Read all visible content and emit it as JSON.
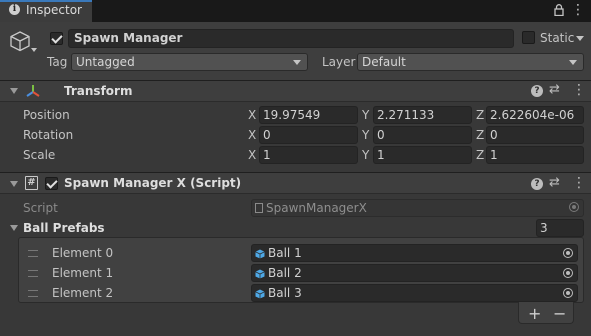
{
  "tab": {
    "label": "Inspector"
  },
  "header": {
    "object_name": "Spawn Manager",
    "static_label": "Static",
    "tag_label": "Tag",
    "tag_value": "Untagged",
    "layer_label": "Layer",
    "layer_value": "Default"
  },
  "transform": {
    "title": "Transform",
    "rows": [
      {
        "label": "Position",
        "x": "19.97549",
        "y": "2.271133",
        "z": "2.622604e-06"
      },
      {
        "label": "Rotation",
        "x": "0",
        "y": "0",
        "z": "0"
      },
      {
        "label": "Scale",
        "x": "1",
        "y": "1",
        "z": "1"
      }
    ],
    "axis": {
      "x": "X",
      "y": "Y",
      "z": "Z"
    }
  },
  "script_component": {
    "title": "Spawn Manager X (Script)",
    "hash_label": "#",
    "script_label": "Script",
    "script_value": "SpawnManagerX",
    "list_label": "Ball Prefabs",
    "list_count": "3",
    "elements": [
      {
        "label": "Element 0",
        "value": "Ball 1"
      },
      {
        "label": "Element 1",
        "value": "Ball 2"
      },
      {
        "label": "Element 2",
        "value": "Ball 3"
      }
    ],
    "add_label": "+",
    "remove_label": "−"
  },
  "icons": {
    "info": "info-icon",
    "lock": "lock-icon",
    "menu": "kebab-menu-icon",
    "cube": "gameobject-cube-icon",
    "transform": "transform-axes-icon",
    "help": "help-icon",
    "preset": "preset-sliders-icon",
    "more": "more-dots-icon",
    "script": "csharp-script-icon",
    "prefab": "prefab-cube-icon",
    "picker": "object-picker-icon"
  },
  "colors": {
    "tab_accent": "#3a79bb",
    "prefab_icon": "#4ea8e6",
    "axis_red": "#e0533a",
    "axis_green": "#7bc043",
    "axis_blue": "#4a8fe0"
  }
}
